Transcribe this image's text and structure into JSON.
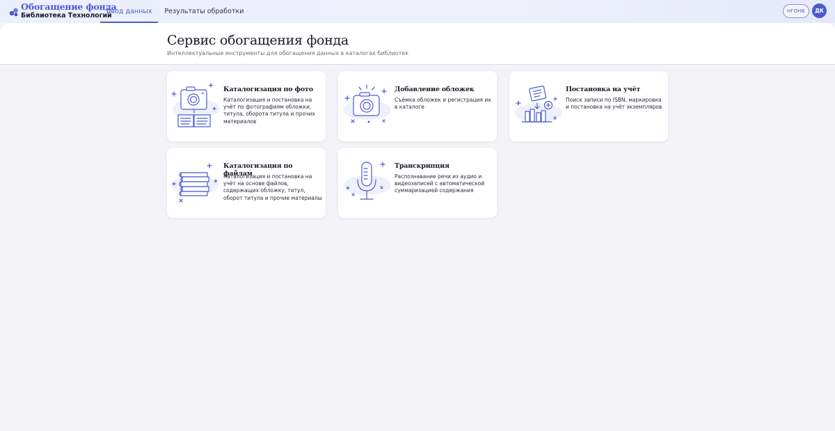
{
  "app": {
    "logo_title": "Обогащение фонда",
    "logo_subtitle": "Библиотека Технологий"
  },
  "nav": {
    "tabs": [
      {
        "label": "Ввод данных",
        "active": true
      },
      {
        "label": "Результаты обработки",
        "active": false
      }
    ]
  },
  "user": {
    "pill_label": "НГОНБ",
    "avatar_initials": "ДК"
  },
  "page": {
    "title": "Сервис обогащения фонда",
    "subtitle": "Интеллектуальные инструменты для обогащения данных в каталогах библиотек"
  },
  "cards": [
    {
      "title": "Каталогизация по фото",
      "description": "Каталогизация и постановка на учёт по фотографиям обложки, титула, оборота титула и прочих материалов",
      "icon": "camera-book-icon"
    },
    {
      "title": "Добавление обложек",
      "description": "Съёмка обложек и регистрация их в каталоге",
      "icon": "camera-flash-icon"
    },
    {
      "title": "Постановка на учёт",
      "description": "Поиск записи по ISBN, маркировка и постановка на учёт экземпляров",
      "icon": "books-add-icon"
    },
    {
      "title": "Каталогизация по файлам",
      "description": "Каталогизация и постановка на учёт на основе файлов, содержащих обложку, титул, оборот титула и прочие материалы",
      "icon": "book-stack-icon"
    },
    {
      "title": "Транскрипция",
      "description": "Распознавание речи из аудио и видеозаписей с автоматической суммаризацией содержания",
      "icon": "microphone-icon"
    }
  ],
  "colors": {
    "accent": "#4a5bd0",
    "background": "#f3f3f8"
  }
}
